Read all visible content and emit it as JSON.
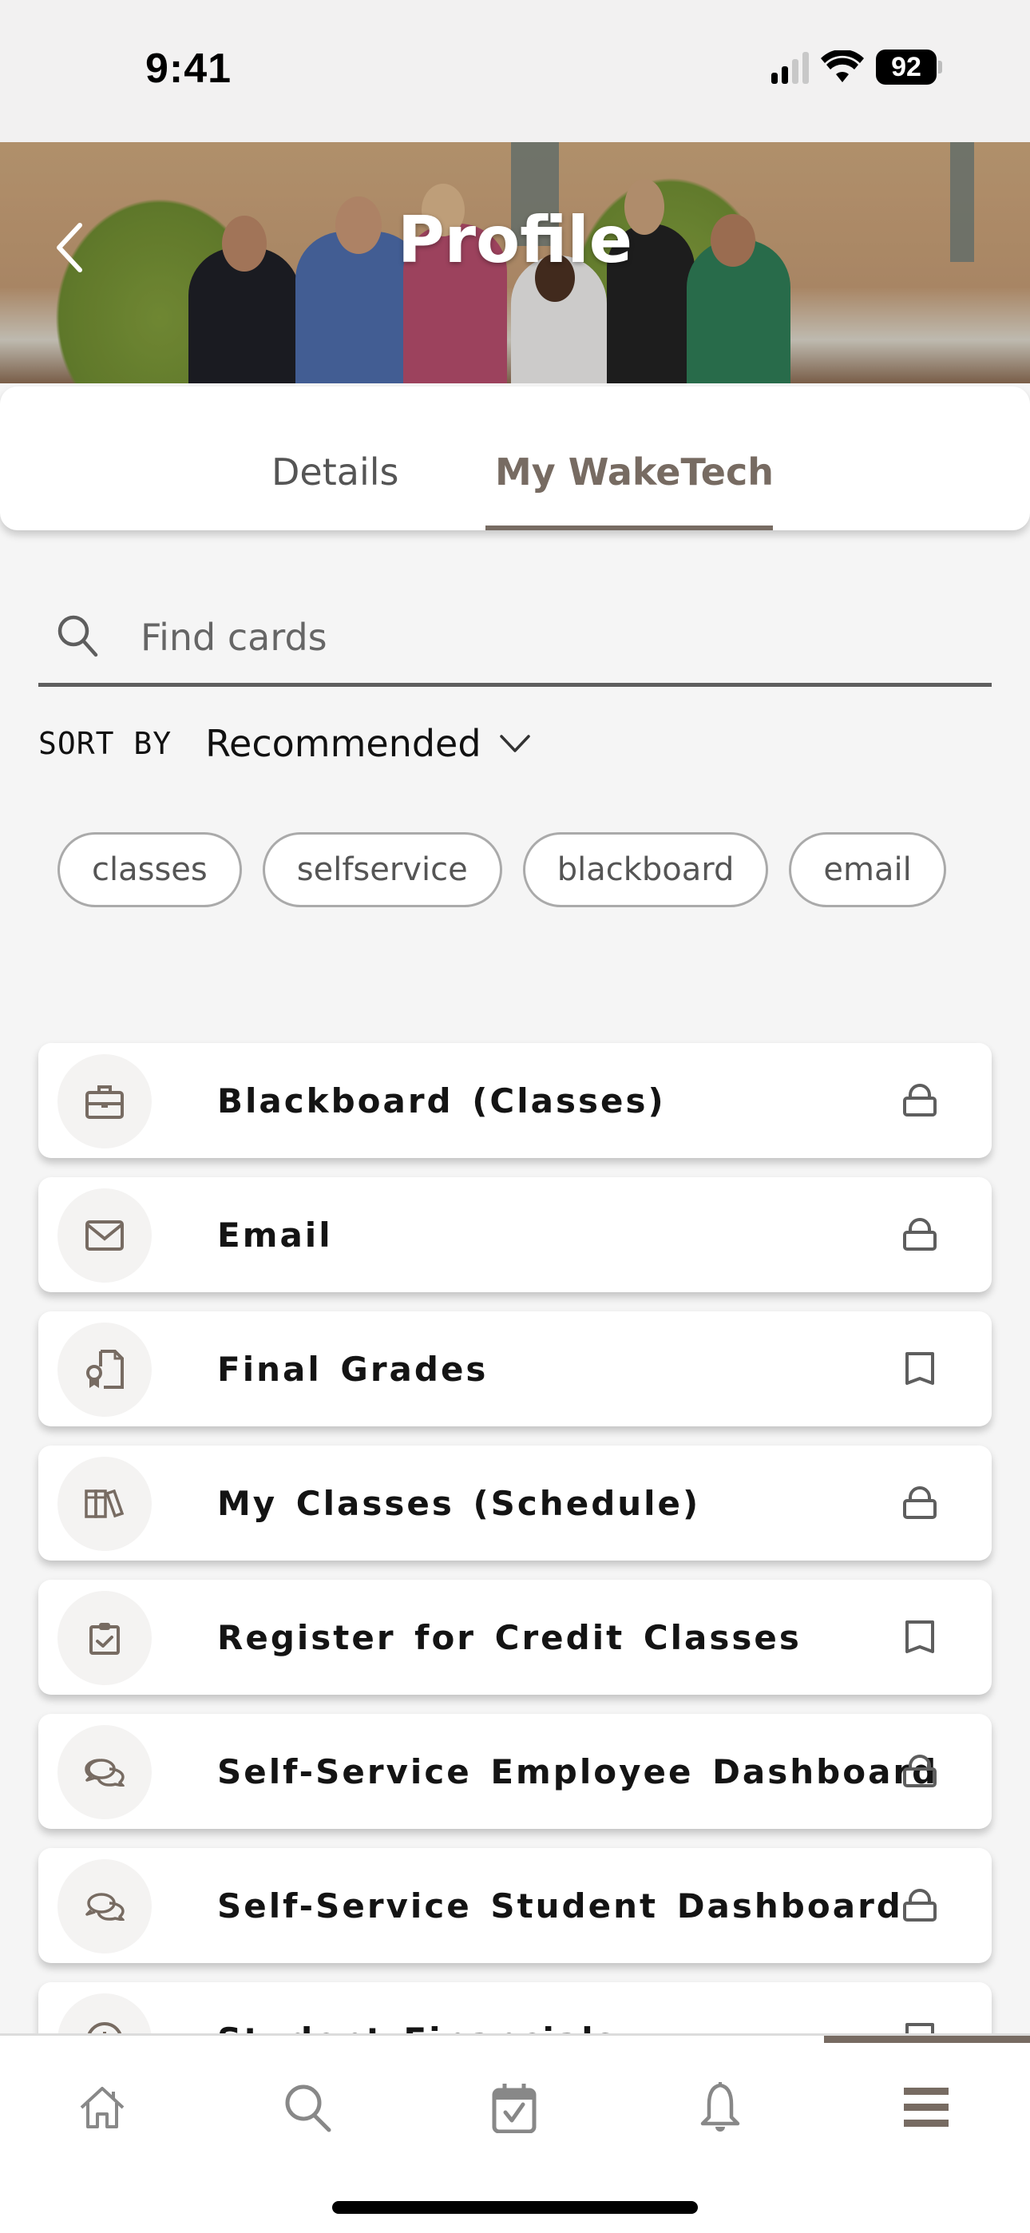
{
  "status_bar": {
    "time": "9:41",
    "battery": "92",
    "signal_bars_active": 2,
    "signal_bars_total": 4
  },
  "header": {
    "title": "Profile",
    "back_icon": "chevron-left-icon"
  },
  "tabs": [
    {
      "label": "Details",
      "active": false
    },
    {
      "label": "My WakeTech",
      "active": true
    }
  ],
  "search": {
    "placeholder": "Find cards",
    "value": "",
    "icon": "search-icon"
  },
  "sort": {
    "label": "SORT BY",
    "selected": "Recommended"
  },
  "chips": [
    "classes",
    "selfservice",
    "blackboard",
    "email"
  ],
  "cards": [
    {
      "title": "Blackboard (Classes)",
      "icon": "briefcase-icon",
      "action": "lock-icon"
    },
    {
      "title": "Email",
      "icon": "envelope-icon",
      "action": "lock-icon"
    },
    {
      "title": "Final Grades",
      "icon": "certificate-document-icon",
      "action": "bookmark-icon"
    },
    {
      "title": "My Classes (Schedule)",
      "icon": "books-icon",
      "action": "lock-icon"
    },
    {
      "title": "Register for Credit Classes",
      "icon": "clipboard-check-icon",
      "action": "bookmark-icon"
    },
    {
      "title": "Self-Service Employee Dashboard",
      "icon": "chat-bubbles-icon",
      "action": "lock-icon"
    },
    {
      "title": "Self-Service Student Dashboard",
      "icon": "chat-bubbles-icon",
      "action": "lock-icon"
    },
    {
      "title": "Student Financials",
      "icon": "info-icon",
      "action": "bookmark-icon"
    }
  ],
  "bottom_nav": [
    {
      "name": "home",
      "icon": "home-icon",
      "active": false
    },
    {
      "name": "search",
      "icon": "search-icon",
      "active": false
    },
    {
      "name": "calendar",
      "icon": "calendar-check-icon",
      "active": false
    },
    {
      "name": "notifications",
      "icon": "bell-icon",
      "active": false
    },
    {
      "name": "menu",
      "icon": "hamburger-menu-icon",
      "active": true
    }
  ],
  "colors": {
    "accent": "#776b62",
    "icon_gray": "#5e5e5e",
    "background": "#f5f5f5"
  }
}
